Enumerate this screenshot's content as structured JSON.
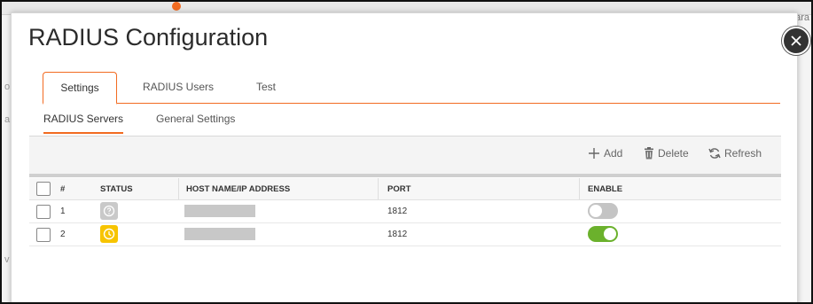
{
  "background": {
    "right_text": "ara",
    "left_chars": [
      "o",
      "a",
      "v"
    ]
  },
  "modal": {
    "title": "RADIUS Configuration"
  },
  "tabs": [
    {
      "label": "Settings",
      "active": true
    },
    {
      "label": "RADIUS Users",
      "active": false
    },
    {
      "label": "Test",
      "active": false
    }
  ],
  "subtabs": [
    {
      "label": "RADIUS Servers",
      "active": true
    },
    {
      "label": "General Settings",
      "active": false
    }
  ],
  "toolbar": {
    "add_label": "Add",
    "delete_label": "Delete",
    "refresh_label": "Refresh"
  },
  "table": {
    "headers": {
      "num": "#",
      "status": "STATUS",
      "host": "HOST NAME/IP ADDRESS",
      "port": "PORT",
      "enable": "ENABLE"
    },
    "rows": [
      {
        "num": "1",
        "status_icon": "question-icon",
        "status_color": "#c9c9c9",
        "port": "1812",
        "enabled": false
      },
      {
        "num": "2",
        "status_icon": "clock-icon",
        "status_color": "#f7c400",
        "port": "1812",
        "enabled": true
      }
    ]
  },
  "colors": {
    "accent": "#f26b21",
    "toggle_on": "#6bb12c",
    "toggle_off": "#c4c4c4"
  }
}
